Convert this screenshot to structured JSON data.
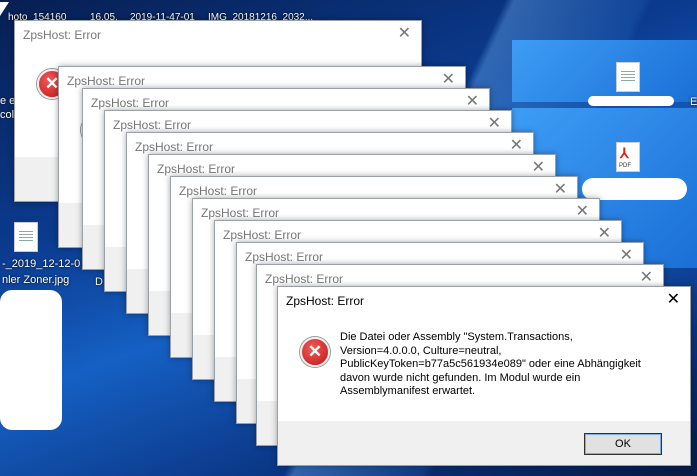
{
  "desktop": {
    "top_labels": [
      "hoto_154160",
      "16.05.",
      "2019-11-47-01",
      "IMG_20181216_2032..."
    ],
    "left_labels": [
      "e e",
      "col",
      "-_2019_12-12-0",
      "nler Zoner.jpg"
    ],
    "right_labels": [
      "D",
      "E"
    ],
    "file_icons": [
      "document-icon",
      "pdf-icon"
    ],
    "pdf_tag": "PDF"
  },
  "dialogs": {
    "title": "ZpsHost: Error",
    "close_glyph": "✕",
    "error_glyph": "✕"
  },
  "front_dialog": {
    "title": "ZpsHost: Error",
    "message": "Die Datei oder Assembly \"System.Transactions,\nVersion=4.0.0.0, Culture=neutral,\nPublicKeyToken=b77a5c561934e089\" oder eine Abhängigkeit\ndavon wurde nicht gefunden. Im Modul wurde ein\nAssemblymanifest erwartet.",
    "ok_label": "OK",
    "close_glyph": "✕",
    "error_glyph": "✕"
  }
}
